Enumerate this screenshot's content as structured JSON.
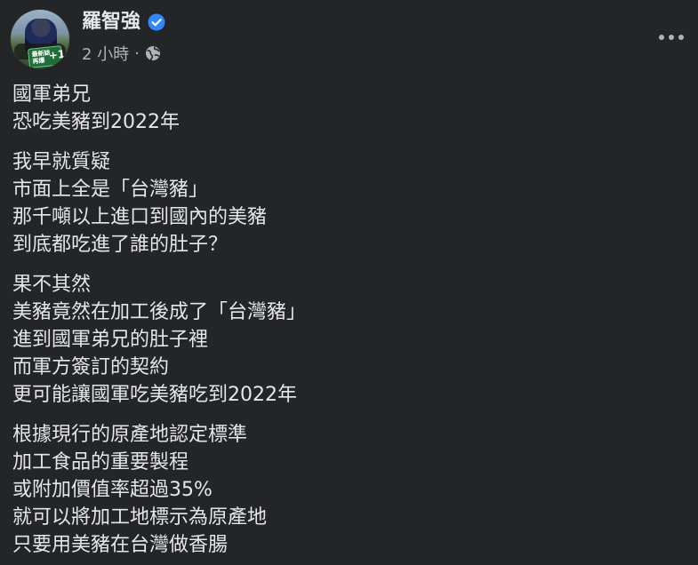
{
  "post": {
    "author_name": "羅智強",
    "timestamp": "2 小時",
    "separator": "·",
    "verified": true,
    "privacy_icon": "globe-icon",
    "more_icon": "more-options-icon",
    "avatar_badge": {
      "line1": "最新誌",
      "line2": "再爆",
      "plus": "+1"
    },
    "paragraphs": [
      {
        "lines": [
          "國軍弟兄",
          "恐吃美豬到2022年"
        ]
      },
      {
        "lines": [
          "我早就質疑",
          "市面上全是「台灣豬」",
          "那千噸以上進口到國內的美豬",
          "到底都吃進了誰的肚子？"
        ]
      },
      {
        "lines": [
          "果不其然",
          "美豬竟然在加工後成了「台灣豬」",
          "進到國軍弟兄的肚子裡",
          "而軍方簽訂的契約",
          "更可能讓國軍吃美豬吃到2022年"
        ]
      },
      {
        "lines": [
          "根據現行的原產地認定標準",
          "加工食品的重要製程",
          "或附加價值率超過35%",
          "就可以將加工地標示為原產地",
          "只要用美豬在台灣做香腸"
        ]
      }
    ]
  },
  "colors": {
    "background": "#242526",
    "primary_text": "#e4e6eb",
    "secondary_text": "#b0b3b8",
    "verified_blue": "#2d88ff"
  }
}
